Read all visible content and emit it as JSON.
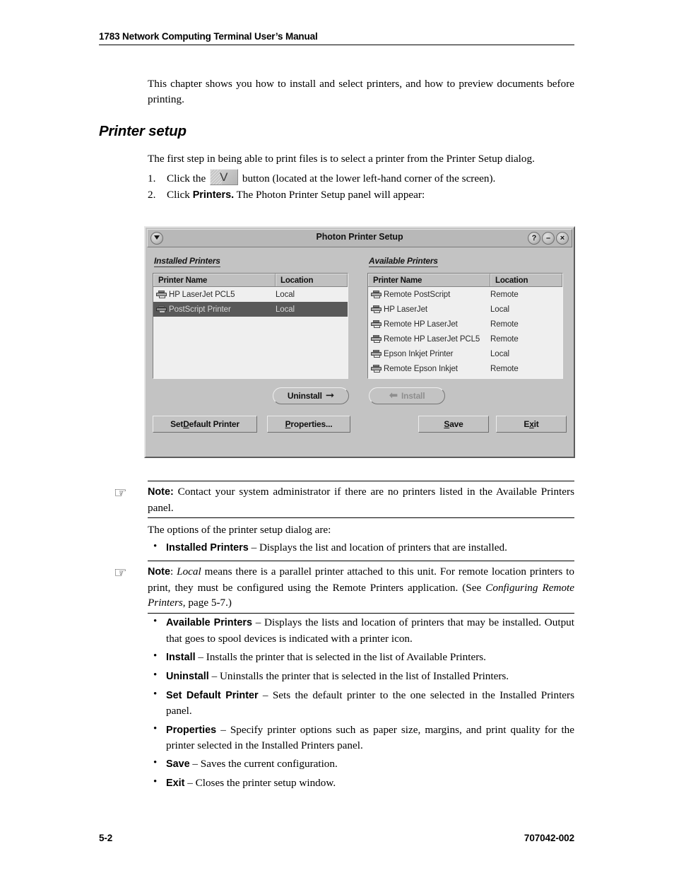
{
  "header": {
    "running_head": "1783 Network Computing Terminal User’s Manual"
  },
  "intro": {
    "paragraph": "This chapter shows you how to install and select printers, and how to preview documents before printing."
  },
  "section": {
    "heading": "Printer setup",
    "lead": "The first step in being able to print files is to select a printer from the Printer Setup dialog.",
    "steps": [
      {
        "number": "1.",
        "text_before": "Click the",
        "icon": "photon-launch-button-icon",
        "text_after": "button (located at the lower left-hand corner of the screen)."
      },
      {
        "number": "2.",
        "text_before": "Click",
        "bold": "Printers.",
        "text_after": "The Photon Printer Setup panel will appear:"
      }
    ]
  },
  "dialog": {
    "title": "Photon Printer Setup",
    "titlebar_buttons": {
      "menu": "▼",
      "help": "?",
      "minimize": "–",
      "close": "×"
    },
    "installed_group_label": "Installed Printers",
    "available_group_label": "Available Printers",
    "columns": [
      "Printer Name",
      "Location"
    ],
    "installed_printers": [
      {
        "name": "HP LaserJet PCL5",
        "location": "Local",
        "selected": false
      },
      {
        "name": "PostScript Printer",
        "location": "Local",
        "selected": true
      }
    ],
    "available_printers": [
      {
        "name": "Remote PostScript",
        "location": "Remote"
      },
      {
        "name": "HP LaserJet",
        "location": "Local"
      },
      {
        "name": "Remote HP LaserJet",
        "location": "Remote"
      },
      {
        "name": "Remote HP LaserJet PCL5",
        "location": "Remote"
      },
      {
        "name": "Epson Inkjet Printer",
        "location": "Local"
      },
      {
        "name": "Remote Epson Inkjet",
        "location": "Remote"
      }
    ],
    "buttons": {
      "uninstall": "Uninstall",
      "install": "Install",
      "set_default_printer_pre": "Set ",
      "set_default_printer_mnemonic": "D",
      "set_default_printer_post": "efault Printer",
      "properties_mnemonic": "P",
      "properties_post": "roperties...",
      "save_mnemonic": "S",
      "save_post": "ave",
      "exit_pre": "E",
      "exit_mnemonic": "x",
      "exit_post": "it"
    },
    "install_disabled": true,
    "colors": {
      "face": "#c3c3c3",
      "list_background": "#efefef",
      "selection_background": "#595959",
      "selection_text": "#d8d8d8",
      "disabled_text": "#8e8e8e"
    }
  },
  "notes": [
    {
      "icon": "pointing-hand-icon",
      "label": "Note:",
      "text": " Contact your system administrator if there are no printers listed in the Available Printers panel."
    },
    {
      "icon": "pointing-hand-icon",
      "label": "Note",
      "text_1": ": ",
      "italic_1": "Local",
      "text_2": " means there is a parallel printer attached to this unit. For remote location printers to print, they must be configured using the Remote Printers application. (See ",
      "italic_2": "Configuring Remote Printers",
      "text_3": ", page 5-7.)"
    }
  ],
  "options_lead": "The options of the printer setup dialog are:",
  "bullets_group_1": [
    {
      "term": "Installed Printers",
      "desc": " – Displays the list and location of printers that are installed."
    }
  ],
  "bullets_group_2": [
    {
      "term": "Available Printers",
      "desc": " – Displays the lists and location of printers that may be installed. Output that goes to spool devices is indicated with a printer icon."
    },
    {
      "term": "Install",
      "desc": " – Installs the printer that is selected in the list of Available Printers."
    },
    {
      "term": "Uninstall",
      "desc": " – Uninstalls the printer that is selected in the list of Installed Printers."
    },
    {
      "term": "Set Default Printer",
      "desc": " – Sets the default printer to the one selected in the Installed Printers panel."
    },
    {
      "term": "Properties",
      "desc": " – Specify printer options such as paper size, margins, and print quality for the printer selected in the Installed Printers panel."
    },
    {
      "term": "Save",
      "desc": " – Saves the current configuration."
    },
    {
      "term": "Exit",
      "desc": " – Closes the printer setup window."
    }
  ],
  "footer": {
    "page_number": "5-2",
    "doc_number": "707042-002"
  }
}
